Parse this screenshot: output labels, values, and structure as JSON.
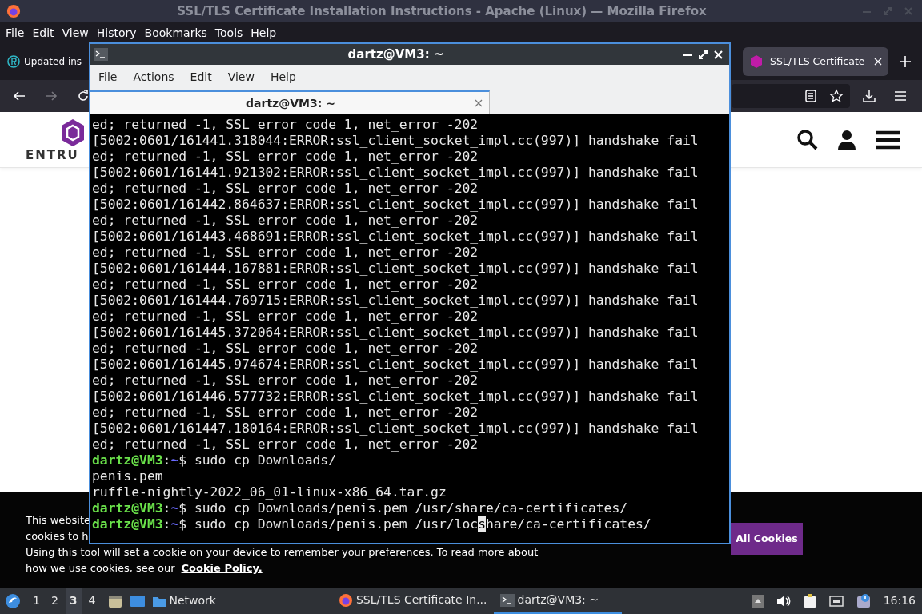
{
  "browser": {
    "title": "SSL/TLS Certificate Installation Instructions - Apache (Linux) — Mozilla Firefox",
    "menu": [
      "File",
      "Edit",
      "View",
      "History",
      "Bookmarks",
      "Tools",
      "Help"
    ],
    "tabs": [
      {
        "label": "Updated ins",
        "selected": false
      },
      {
        "label": "SSL/TLS Certificate",
        "selected": true
      }
    ]
  },
  "page": {
    "logo_text": "ENTRU",
    "cookie_banner": {
      "lines": [
        "This website",
        "cookies to h",
        "Using this tool will set a cookie on your device to remember your preferences. To read more about"
      ],
      "last_line": "how we use cookies, see our",
      "link": "Cookie Policy.",
      "button": "All Cookies"
    }
  },
  "terminal": {
    "title": "dartz@VM3: ~",
    "menu": [
      "File",
      "Actions",
      "Edit",
      "View",
      "Help"
    ],
    "tab": "dartz@VM3: ~",
    "lines": [
      {
        "kind": "output",
        "text": "ed; returned -1, SSL error code 1, net_error -202"
      },
      {
        "kind": "output",
        "text": "[5002:0601/161441.318044:ERROR:ssl_client_socket_impl.cc(997)] handshake fail"
      },
      {
        "kind": "output",
        "text": "ed; returned -1, SSL error code 1, net_error -202"
      },
      {
        "kind": "output",
        "text": "[5002:0601/161441.921302:ERROR:ssl_client_socket_impl.cc(997)] handshake fail"
      },
      {
        "kind": "output",
        "text": "ed; returned -1, SSL error code 1, net_error -202"
      },
      {
        "kind": "output",
        "text": "[5002:0601/161442.864637:ERROR:ssl_client_socket_impl.cc(997)] handshake fail"
      },
      {
        "kind": "output",
        "text": "ed; returned -1, SSL error code 1, net_error -202"
      },
      {
        "kind": "output",
        "text": "[5002:0601/161443.468691:ERROR:ssl_client_socket_impl.cc(997)] handshake fail"
      },
      {
        "kind": "output",
        "text": "ed; returned -1, SSL error code 1, net_error -202"
      },
      {
        "kind": "output",
        "text": "[5002:0601/161444.167881:ERROR:ssl_client_socket_impl.cc(997)] handshake fail"
      },
      {
        "kind": "output",
        "text": "ed; returned -1, SSL error code 1, net_error -202"
      },
      {
        "kind": "output",
        "text": "[5002:0601/161444.769715:ERROR:ssl_client_socket_impl.cc(997)] handshake fail"
      },
      {
        "kind": "output",
        "text": "ed; returned -1, SSL error code 1, net_error -202"
      },
      {
        "kind": "output",
        "text": "[5002:0601/161445.372064:ERROR:ssl_client_socket_impl.cc(997)] handshake fail"
      },
      {
        "kind": "output",
        "text": "ed; returned -1, SSL error code 1, net_error -202"
      },
      {
        "kind": "output",
        "text": "[5002:0601/161445.974674:ERROR:ssl_client_socket_impl.cc(997)] handshake fail"
      },
      {
        "kind": "output",
        "text": "ed; returned -1, SSL error code 1, net_error -202"
      },
      {
        "kind": "output",
        "text": "[5002:0601/161446.577732:ERROR:ssl_client_socket_impl.cc(997)] handshake fail"
      },
      {
        "kind": "output",
        "text": "ed; returned -1, SSL error code 1, net_error -202"
      },
      {
        "kind": "output",
        "text": "[5002:0601/161447.180164:ERROR:ssl_client_socket_impl.cc(997)] handshake fail"
      },
      {
        "kind": "output",
        "text": "ed; returned -1, SSL error code 1, net_error -202"
      },
      {
        "kind": "prompt",
        "user": "dartz@VM3",
        "sep": ":",
        "path": "~",
        "sigil": "$",
        "command": "sudo cp Downloads/"
      },
      {
        "kind": "output",
        "text": "penis.pem"
      },
      {
        "kind": "output",
        "text": "ruffle-nightly-2022_06_01-linux-x86_64.tar.gz"
      },
      {
        "kind": "prompt",
        "user": "dartz@VM3",
        "sep": ":",
        "path": "~",
        "sigil": "$",
        "command": "sudo cp Downloads/penis.pem /usr/share/ca-certificates/"
      },
      {
        "kind": "prompt",
        "user": "dartz@VM3",
        "sep": ":",
        "path": "~",
        "sigil": "$",
        "command": "sudo cp Downloads/penis.pem /usr/loc",
        "cursor": "s",
        "command_rest": "hare/ca-certificates/"
      }
    ]
  },
  "taskbar": {
    "workspaces": [
      {
        "label": "1",
        "selected": false
      },
      {
        "label": "2",
        "selected": false
      },
      {
        "label": "3",
        "selected": true
      },
      {
        "label": "4",
        "selected": false
      }
    ],
    "launcher": "Network",
    "tasks": [
      {
        "kind": "browser",
        "label": "SSL/TLS Certificate In...",
        "selected": false
      },
      {
        "kind": "terminal",
        "label": "dartz@VM3: ~",
        "selected": true
      }
    ],
    "clock": "16:16"
  }
}
